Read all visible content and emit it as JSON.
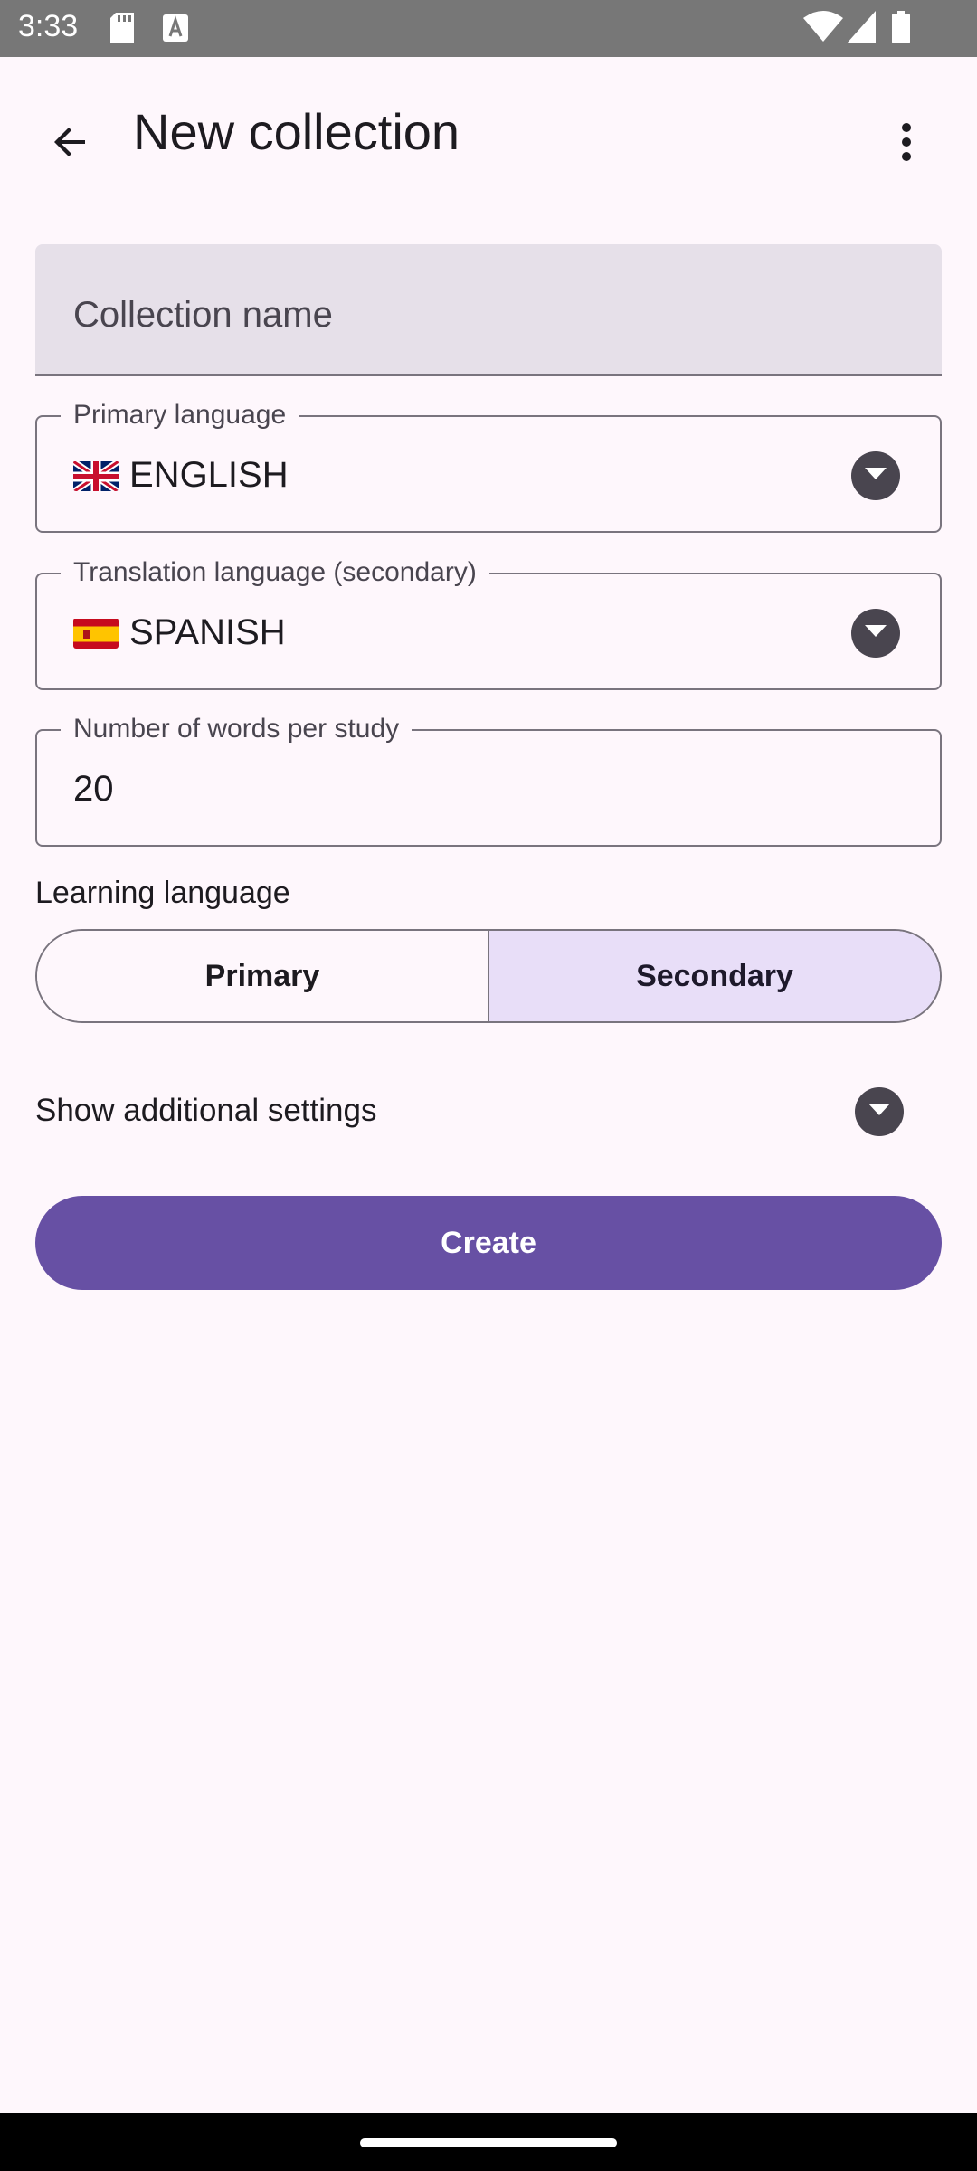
{
  "status_bar": {
    "time": "3:33",
    "icons": [
      "sd-card-icon",
      "text-a-icon",
      "wifi-icon",
      "signal-icon",
      "battery-icon"
    ]
  },
  "app_bar": {
    "title": "New collection",
    "back_icon": "arrow-back-icon",
    "more_icon": "more-vert-icon"
  },
  "form": {
    "collection_name": {
      "placeholder": "Collection name",
      "value": ""
    },
    "primary_language": {
      "label": "Primary language",
      "value": "ENGLISH",
      "flag": "uk-flag-icon"
    },
    "translation_language": {
      "label": "Translation language (secondary)",
      "value": "SPANISH",
      "flag": "spain-flag-icon"
    },
    "words_per_study": {
      "label": "Number of words per study",
      "value": "20"
    },
    "learning_language": {
      "label": "Learning language",
      "options": [
        "Primary",
        "Secondary"
      ],
      "selected": "Secondary"
    },
    "additional_settings": {
      "label": "Show additional settings"
    },
    "create_label": "Create"
  },
  "colors": {
    "background": "#fef7fc",
    "accent": "#6750a4",
    "selected_segment": "#e8def8",
    "filled_field": "#e6e0e9",
    "outline": "#79747e"
  }
}
